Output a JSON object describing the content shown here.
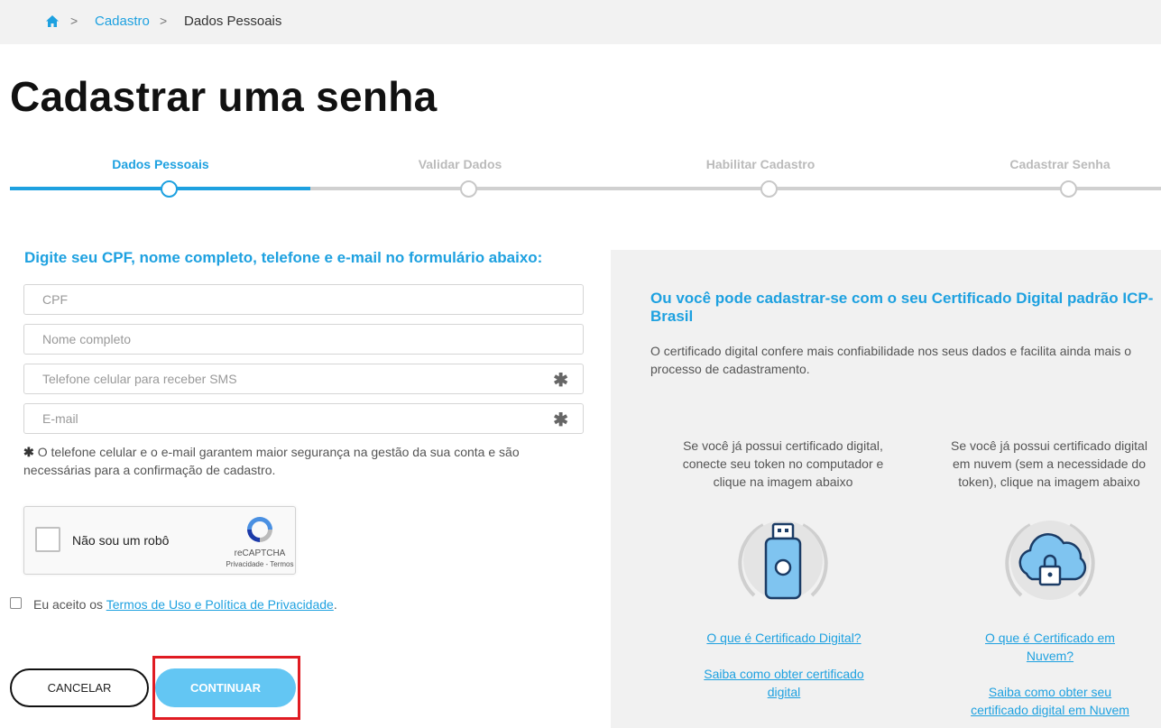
{
  "breadcrumb": {
    "home_icon": "home-icon",
    "separator": ">",
    "items": [
      "Cadastro",
      "Dados Pessoais"
    ]
  },
  "page_title": "Cadastrar uma senha",
  "steps": [
    "Dados Pessoais",
    "Validar Dados",
    "Habilitar Cadastro",
    "Cadastrar Senha"
  ],
  "active_step": "Dados Pessoais",
  "form": {
    "heading": "Digite seu CPF, nome completo, telefone e e-mail no formulário abaixo:",
    "fields": {
      "cpf": {
        "placeholder": "CPF",
        "value": ""
      },
      "name": {
        "placeholder": "Nome completo",
        "value": ""
      },
      "phone": {
        "placeholder": "Telefone celular para receber SMS",
        "value": ""
      },
      "email": {
        "placeholder": "E-mail",
        "value": ""
      }
    },
    "required_marker": "✱",
    "note": "O telefone celular e o e-mail garantem maior segurança na gestão da sua conta e são necessárias para a confirmação de cadastro."
  },
  "recaptcha": {
    "label": "Não sou um robô",
    "brand": "reCAPTCHA",
    "links": "Privacidade - Termos"
  },
  "accept": {
    "prefix": "Eu aceito os",
    "link": "Termos de Uso e Política de Privacidade",
    "suffix": "."
  },
  "buttons": {
    "cancel": "CANCELAR",
    "continue": "CONTINUAR"
  },
  "side": {
    "title": "Ou você pode cadastrar-se com o seu Certificado Digital padrão ICP-Brasil",
    "description": "O certificado digital confere mais confiabilidade nos seus dados e facilita ainda mais o processo de cadastramento.",
    "token": {
      "text": "Se você já possui certificado digital, conecte seu token no computador e clique na imagem abaixo",
      "icon": "usb-token-icon",
      "link1": "O que é Certificado Digital?",
      "link2": "Saiba como obter certificado digital"
    },
    "cloud": {
      "text": "Se você já possui certificado digital em nuvem (sem a necessidade do token), clique na imagem abaixo",
      "icon": "cloud-lock-icon",
      "link1": "O que é Certificado em Nuvem?",
      "link2": "Saiba como obter seu certificado digital em Nuvem"
    }
  },
  "colors": {
    "accent": "#1ea1e0",
    "continue_button": "#63c6f3",
    "highlight_frame": "#e01b22"
  }
}
